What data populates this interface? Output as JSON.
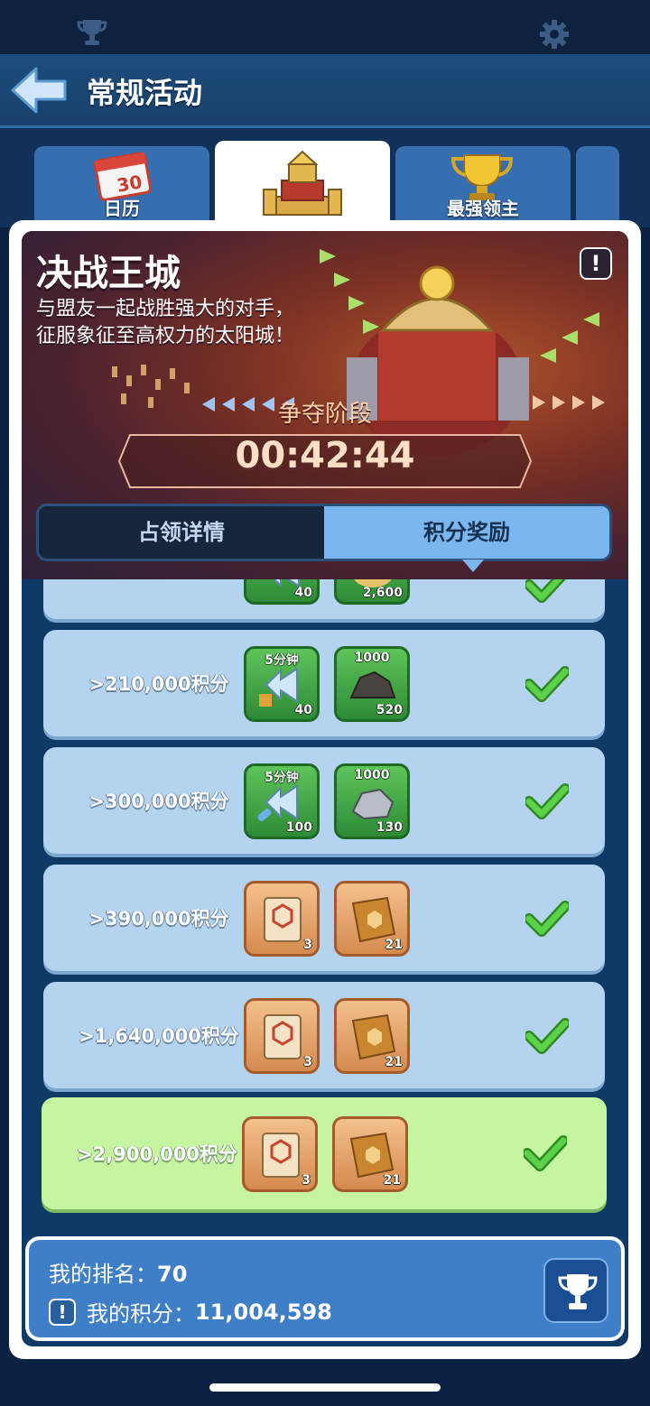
{
  "colors": {
    "accent": "#7bb6ee",
    "check": "#47b53a",
    "highlight_row": "#c6f5a2",
    "row": "#b4d3ef"
  },
  "topbar": {
    "left_icon": "trophy-icon",
    "right_icon": "gear-icon"
  },
  "header": {
    "back_icon": "back-arrow-icon",
    "title": "常规活动"
  },
  "tabs": [
    {
      "label": "日历",
      "icon": "calendar-icon",
      "calendar_day": "30"
    },
    {
      "label": "",
      "icon": "castle-icon",
      "selected": true
    },
    {
      "label": "最强领主",
      "icon": "trophy-icon"
    },
    {
      "label": "",
      "icon": "more-tab"
    }
  ],
  "banner": {
    "title": "决战王城",
    "desc_line1": "与盟友一起战胜强大的对手，",
    "desc_line2": "征服象征至高权力的太阳城！",
    "info_icon": "!",
    "phase": "争夺阶段",
    "timer": "00:42:44"
  },
  "segment": {
    "left": "占领详情",
    "right": "积分奖励",
    "active": "right"
  },
  "rewards": [
    {
      "label": "",
      "items": [
        {
          "top": "",
          "count": "40",
          "icon": "speedup-icon",
          "style": "green"
        },
        {
          "top": "",
          "count": "2,600",
          "icon": "resource-icon",
          "style": "green"
        }
      ],
      "claimed": true
    },
    {
      "label": ">210,000积分",
      "items": [
        {
          "top": "5分钟",
          "count": "40",
          "icon": "speedup-icon",
          "style": "green"
        },
        {
          "top": "1000",
          "count": "520",
          "icon": "ore-icon",
          "style": "green"
        }
      ],
      "claimed": true
    },
    {
      "label": ">300,000积分",
      "items": [
        {
          "top": "5分钟",
          "count": "100",
          "icon": "heal-speedup-icon",
          "style": "green"
        },
        {
          "top": "1000",
          "count": "130",
          "icon": "stone-icon",
          "style": "green"
        }
      ],
      "claimed": true
    },
    {
      "label": ">390,000积分",
      "items": [
        {
          "top": "",
          "count": "3",
          "icon": "scroll-icon",
          "style": "orange"
        },
        {
          "top": "",
          "count": "21",
          "icon": "book-icon",
          "style": "orange"
        }
      ],
      "claimed": true
    },
    {
      "label": ">1,640,000积分",
      "items": [
        {
          "top": "",
          "count": "3",
          "icon": "scroll-icon",
          "style": "orange"
        },
        {
          "top": "",
          "count": "21",
          "icon": "book-icon",
          "style": "orange"
        }
      ],
      "claimed": true
    },
    {
      "label": ">2,900,000积分",
      "items": [
        {
          "top": "",
          "count": "3",
          "icon": "scroll-icon",
          "style": "orange"
        },
        {
          "top": "",
          "count": "21",
          "icon": "book-icon",
          "style": "orange"
        }
      ],
      "claimed": true,
      "highlight": true
    }
  ],
  "mine": {
    "rank_label": "我的排名：",
    "rank_value": "70",
    "score_label": "我的积分：",
    "score_value": "11,004,598",
    "score_icon": "!",
    "button_icon": "trophy-icon"
  }
}
